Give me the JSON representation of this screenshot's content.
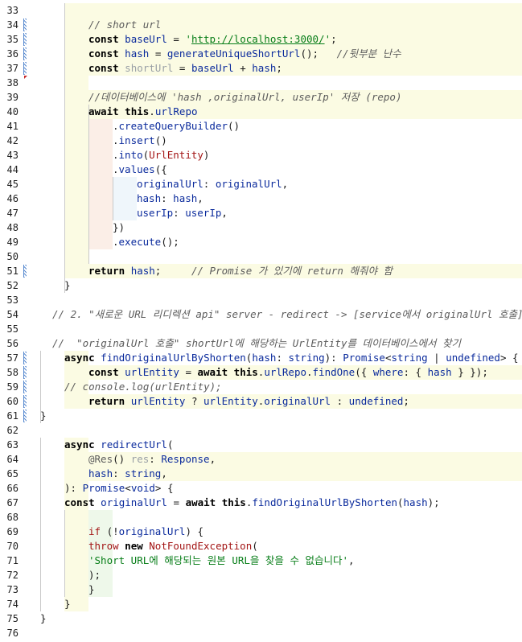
{
  "editor": {
    "lines": [
      {
        "n": "33"
      },
      {
        "n": "34",
        "code": "// short url"
      },
      {
        "n": "35",
        "code": "const baseUrl = 'http://localhost:3000/';"
      },
      {
        "n": "36",
        "code": "const hash = generateUniqueShortUrl();   //뒷부분 난수"
      },
      {
        "n": "37",
        "code": "const shortUrl = baseUrl + hash;"
      },
      {
        "n": "38"
      },
      {
        "n": "39",
        "code": "//데이터베이스에 'hash ,originalUrl, userIp' 저장 (repo)"
      },
      {
        "n": "40",
        "code": "await this.urlRepo"
      },
      {
        "n": "41",
        "code": ".createQueryBuilder()"
      },
      {
        "n": "42",
        "code": ".insert()"
      },
      {
        "n": "43",
        "code": ".into(UrlEntity)"
      },
      {
        "n": "44",
        "code": ".values({"
      },
      {
        "n": "45",
        "code": "originalUrl: originalUrl,"
      },
      {
        "n": "46",
        "code": "hash: hash,"
      },
      {
        "n": "47",
        "code": "userIp: userIp,"
      },
      {
        "n": "48",
        "code": "})"
      },
      {
        "n": "49",
        "code": ".execute();"
      },
      {
        "n": "50"
      },
      {
        "n": "51",
        "code": "return hash;     // Promise 가 있기에 return 해줘야 함"
      },
      {
        "n": "52",
        "code": "}"
      },
      {
        "n": "53"
      },
      {
        "n": "54",
        "code": "// 2. \"새로운 URL 리디렉션 api\" server - redirect -> [service에서 originalUrl 호출]"
      },
      {
        "n": "55"
      },
      {
        "n": "56",
        "code": "//  \"originalUrl 호출\" shortUrl에 해당하는 UrlEntity를 데이터베이스에서 찾기"
      },
      {
        "n": "57",
        "code": "async findOriginalUrlByShorten(hash: string): Promise<string | undefined> {"
      },
      {
        "n": "58",
        "code": "const urlEntity = await this.urlRepo.findOne({ where: { hash } });"
      },
      {
        "n": "59",
        "code": "// console.log(urlEntity);"
      },
      {
        "n": "60",
        "code": "return urlEntity ? urlEntity.originalUrl : undefined;"
      },
      {
        "n": "61",
        "code": "}"
      },
      {
        "n": "62"
      },
      {
        "n": "63",
        "code": "async redirectUrl("
      },
      {
        "n": "64",
        "code": "@Res() res: Response,"
      },
      {
        "n": "65",
        "code": "hash: string,"
      },
      {
        "n": "66",
        "code": "): Promise<void> {"
      },
      {
        "n": "67",
        "code": "const originalUrl = await this.findOriginalUrlByShorten(hash);"
      },
      {
        "n": "68"
      },
      {
        "n": "69",
        "code": "if (!originalUrl) {"
      },
      {
        "n": "70",
        "code": "throw new NotFoundException("
      },
      {
        "n": "71",
        "code": "'Short URL에 해당되는 원본 URL을 찾을 수 없습니다',"
      },
      {
        "n": "72",
        "code": ");"
      },
      {
        "n": "73",
        "code": "}"
      },
      {
        "n": "74",
        "code": "}"
      },
      {
        "n": "75",
        "code": "}"
      },
      {
        "n": "76"
      }
    ]
  },
  "colors": {
    "keyword": "#000000",
    "identifier": "#0a2a9c",
    "string": "#067d17",
    "comment": "#5c5c5c",
    "error": "#a31515",
    "gutter_marker": "#5a8bd0",
    "band_yellow": "#fbfbe3",
    "band_green": "#eef8ea",
    "band_rose": "#fbeee7",
    "band_blue": "#eff6fb"
  },
  "icons": {
    "gutter_change": "vcs-changed-marker-icon",
    "gutter_breakpoint": "error-marker-icon"
  }
}
